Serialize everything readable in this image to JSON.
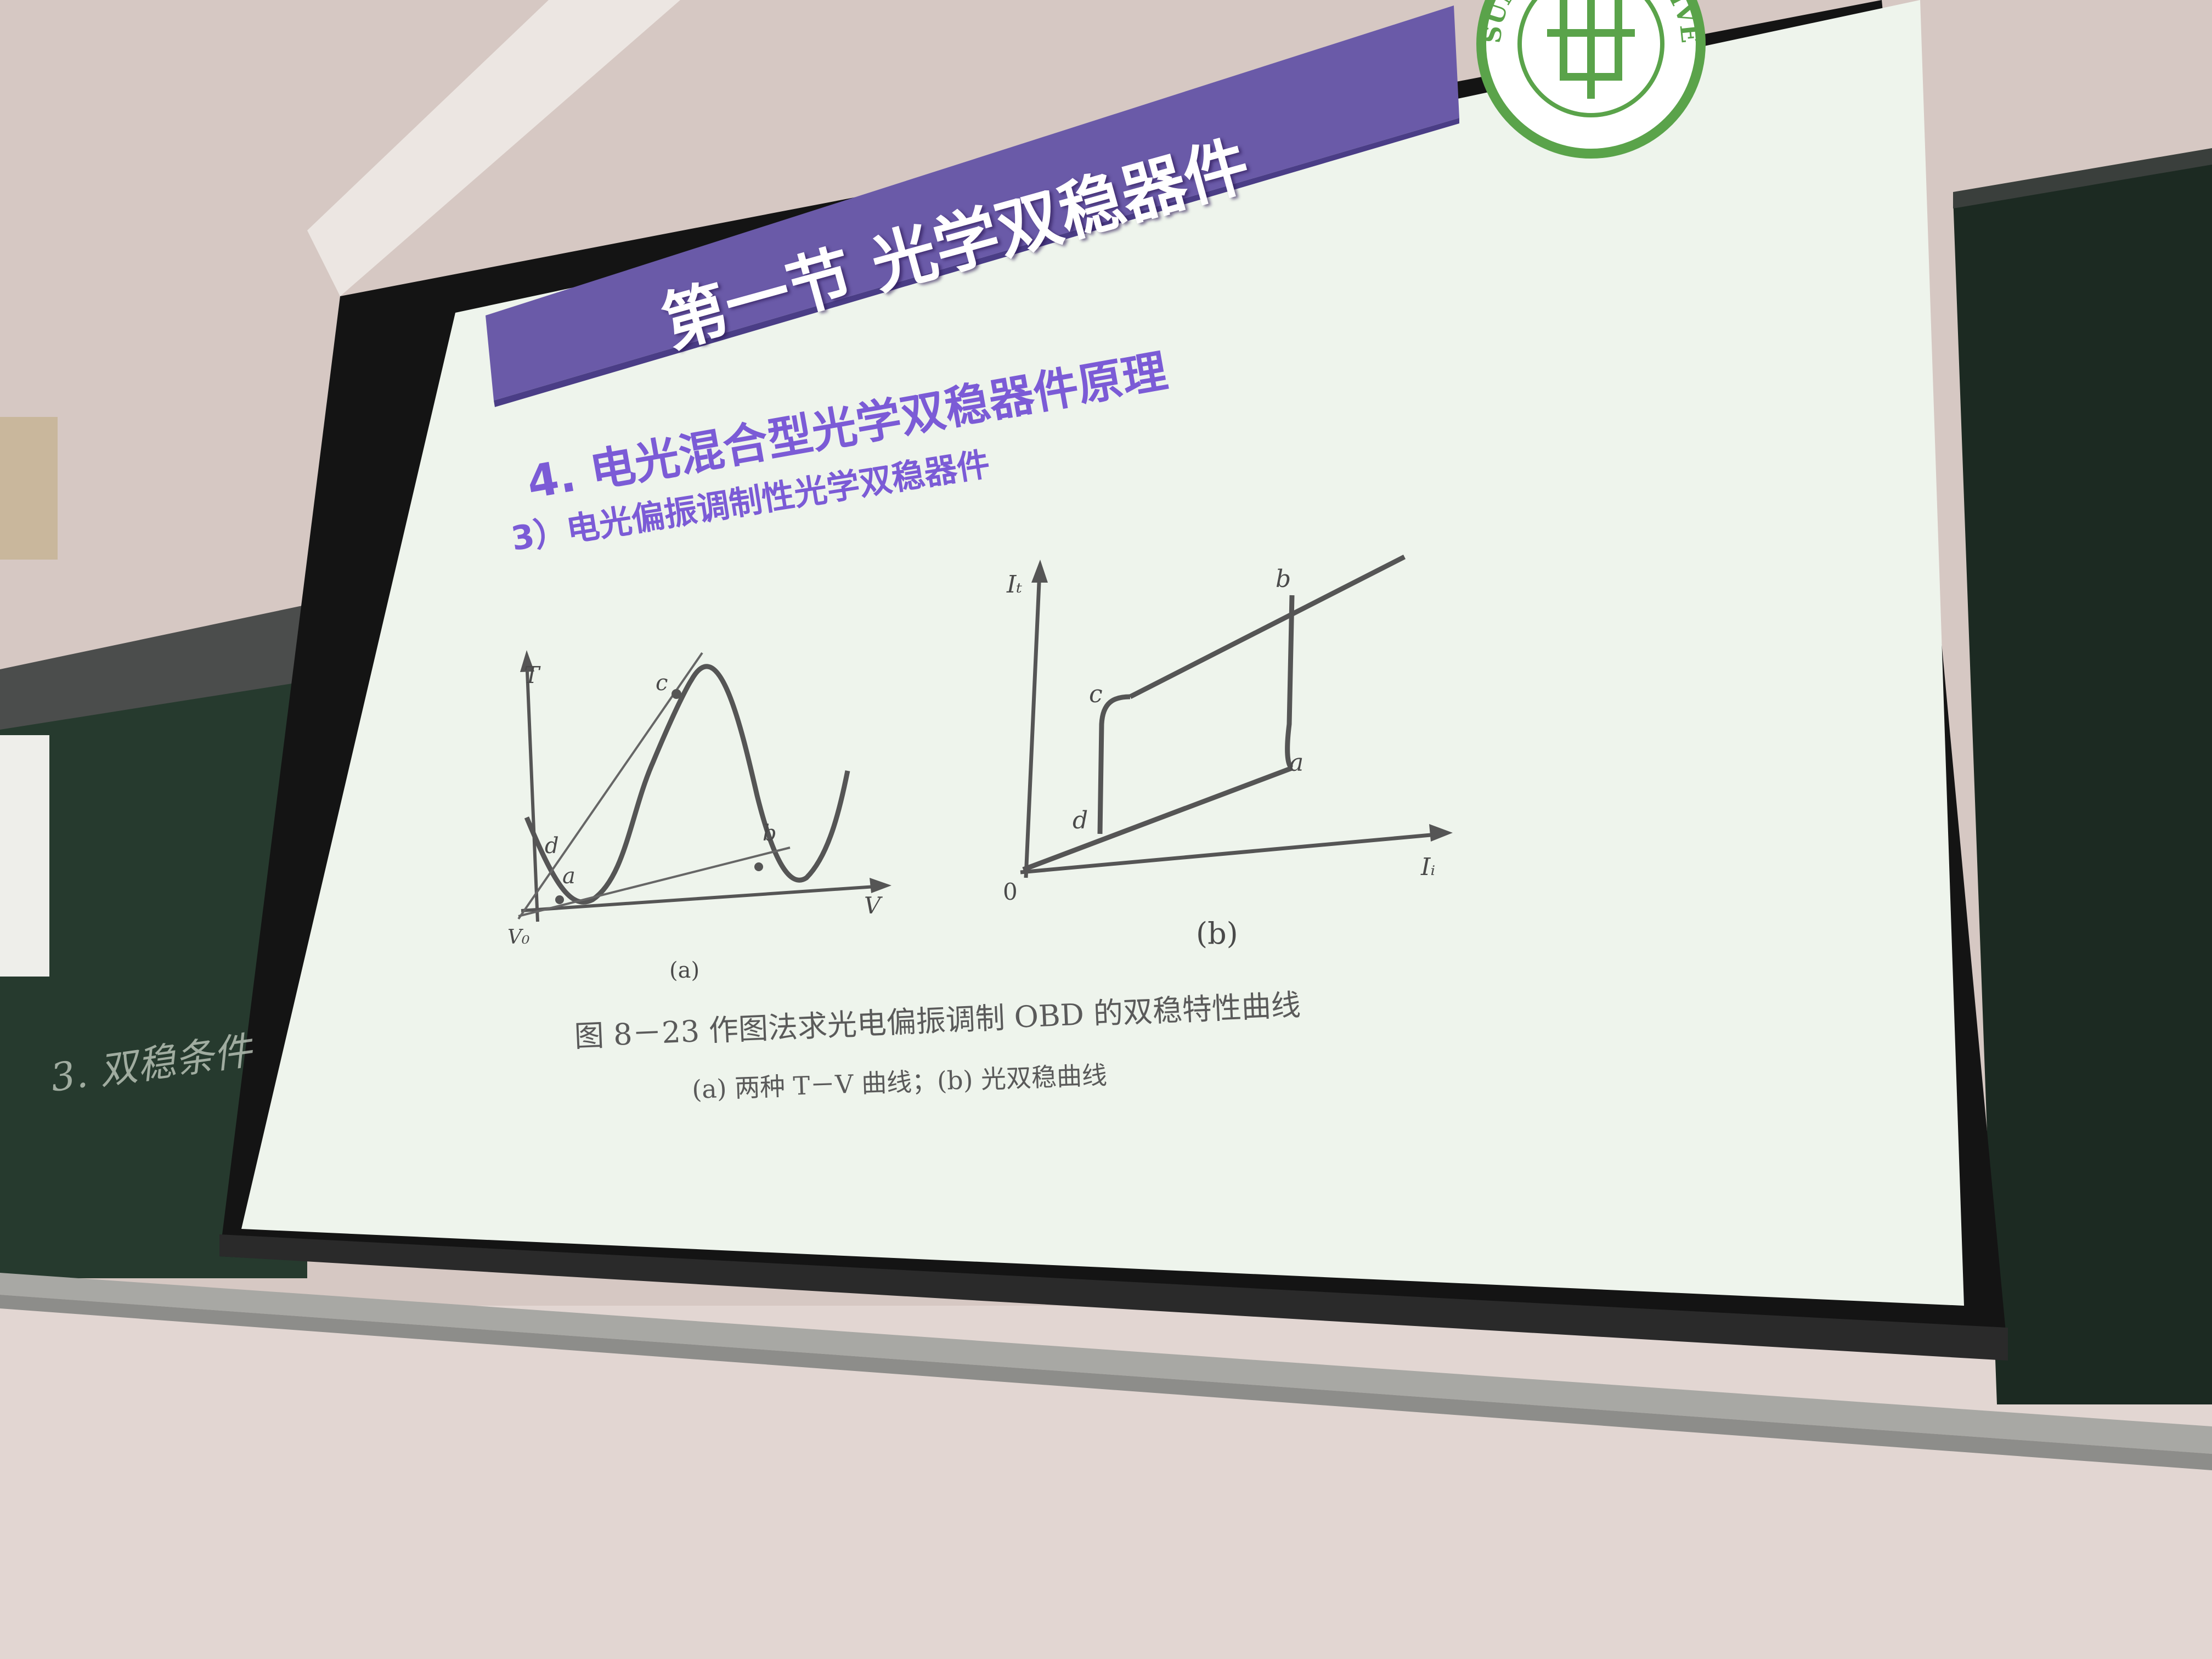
{
  "slide": {
    "title": "第一节 光学双稳器件",
    "heading": "4. 电光混合型光学双稳器件原理",
    "subheading": "3）电光偏振调制性光学双稳器件",
    "logo_text": "SUN YAT-SEN UNIVERSITY",
    "figure": {
      "panel_a": {
        "axis_y": "T",
        "axis_x": "V",
        "origin": "V₀",
        "points": [
          "c",
          "d",
          "a",
          "b"
        ],
        "label": "(a)"
      },
      "panel_b": {
        "axis_y": "Iₜ",
        "axis_x": "Iᵢ",
        "origin": "0",
        "points": [
          "b",
          "c",
          "a",
          "d"
        ],
        "label": "(b)"
      },
      "caption_main": "图 8－23   作图法求光电偏振调制 OBD 的双稳特性曲线",
      "caption_sub": "(a) 两种 T－V 曲线；(b) 光双稳曲线"
    }
  },
  "blackboard": {
    "handwriting": "3. 双稳条件"
  },
  "colors": {
    "title_bar": "#6a5aa8",
    "heading": "#7b5bd6",
    "screen": "#eef4ec",
    "wall": "#d9cbc6",
    "blackboard": "#1f2c24",
    "logo": "#5aa34a"
  }
}
